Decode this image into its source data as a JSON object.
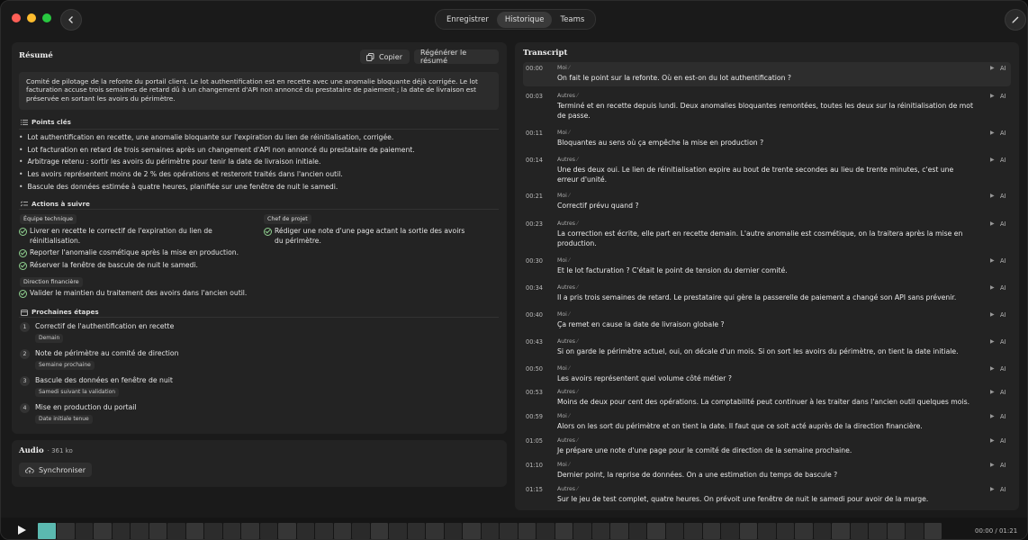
{
  "colors": {
    "accent": "#5bb9b0",
    "check": "#8fd08f",
    "red": "#ff5f57",
    "yellow": "#febc2e",
    "green": "#28c840"
  },
  "icons": {
    "back": "chevron-left-icon",
    "edit": "pencil-icon",
    "copy": "copy-icon",
    "sync": "cloud-sync-icon",
    "play": "play-icon"
  },
  "header": {
    "tabs": [
      "Enregistrer",
      "Historique",
      "Teams"
    ],
    "active_tab": "Historique"
  },
  "summary": {
    "title": "Résumé",
    "copy_label": "Copier",
    "regen_label": "Régénérer le résumé",
    "text": "Comité de pilotage de la refonte du portail client. Le lot authentification est en recette avec une anomalie bloquante déjà corrigée. Le lot facturation accuse trois semaines de retard dû à un changement d'API non annoncé du prestataire de paiement ; la date de livraison est préservée en sortant les avoirs du périmètre.",
    "key_points_title": "Points clés",
    "key_points": [
      "Lot authentification en recette, une anomalie bloquante sur l'expiration du lien de réinitialisation, corrigée.",
      "Lot facturation en retard de trois semaines après un changement d'API non annoncé du prestataire de paiement.",
      "Arbitrage retenu : sortir les avoirs du périmètre pour tenir la date de livraison initiale.",
      "Les avoirs représentent moins de 2 % des opérations et resteront traités dans l'ancien outil.",
      "Bascule des données estimée à quatre heures, planifiée sur une fenêtre de nuit le samedi."
    ],
    "actions_title": "Actions à suivre",
    "actions": {
      "tech_owner": "Équipe technique",
      "tech_items": [
        "Livrer en recette le correctif de l'expiration du lien de réinitialisation.",
        "Reporter l'anomalie cosmétique après la mise en production.",
        "Réserver la fenêtre de bascule de nuit le samedi."
      ],
      "project_owner": "Chef de projet",
      "project_items": [
        "Rédiger une note d'une page actant la sortie des avoirs du périmètre."
      ],
      "finance_owner": "Direction financière",
      "finance_items": [
        "Valider le maintien du traitement des avoirs dans l'ancien outil."
      ]
    },
    "next_steps_title": "Prochaines étapes",
    "next_steps": [
      {
        "num": "1",
        "title": "Correctif de l'authentification en recette",
        "when": "Demain"
      },
      {
        "num": "2",
        "title": "Note de périmètre au comité de direction",
        "when": "Semaine prochaine"
      },
      {
        "num": "3",
        "title": "Bascule des données en fenêtre de nuit",
        "when": "Samedi suivant la validation"
      },
      {
        "num": "4",
        "title": "Mise en production du portail",
        "when": "Date initiale tenue"
      }
    ]
  },
  "audio": {
    "title": "Audio",
    "size": "· 361 ko",
    "sync_label": "Synchroniser"
  },
  "transcript": {
    "title": "Transcript",
    "ai_label": "AI",
    "rows": [
      {
        "time": "00:00",
        "speaker": "Moi",
        "text": "On fait le point sur la refonte. Où en est-on du lot authentification ?"
      },
      {
        "time": "00:03",
        "speaker": "Autres",
        "text": "Terminé et en recette depuis lundi. Deux anomalies bloquantes remontées, toutes les deux sur la réinitialisation de mot de passe."
      },
      {
        "time": "00:11",
        "speaker": "Moi",
        "text": "Bloquantes au sens où ça empêche la mise en production ?"
      },
      {
        "time": "00:14",
        "speaker": "Autres",
        "text": "Une des deux oui. Le lien de réinitialisation expire au bout de trente secondes au lieu de trente minutes, c'est une erreur d'unité."
      },
      {
        "time": "00:21",
        "speaker": "Moi",
        "text": "Correctif prévu quand ?"
      },
      {
        "time": "00:23",
        "speaker": "Autres",
        "text": "La correction est écrite, elle part en recette demain. L'autre anomalie est cosmétique, on la traitera après la mise en production."
      },
      {
        "time": "00:30",
        "speaker": "Moi",
        "text": "Et le lot facturation ? C'était le point de tension du dernier comité."
      },
      {
        "time": "00:34",
        "speaker": "Autres",
        "text": "Il a pris trois semaines de retard. Le prestataire qui gère la passerelle de paiement a changé son API sans prévenir."
      },
      {
        "time": "00:40",
        "speaker": "Moi",
        "text": "Ça remet en cause la date de livraison globale ?"
      },
      {
        "time": "00:43",
        "speaker": "Autres",
        "text": "Si on garde le périmètre actuel, oui, on décale d'un mois. Si on sort les avoirs du périmètre, on tient la date initiale."
      },
      {
        "time": "00:50",
        "speaker": "Moi",
        "text": "Les avoirs représentent quel volume côté métier ?"
      },
      {
        "time": "00:53",
        "speaker": "Autres",
        "text": "Moins de deux pour cent des opérations. La comptabilité peut continuer à les traiter dans l'ancien outil quelques mois."
      },
      {
        "time": "00:59",
        "speaker": "Moi",
        "text": "Alors on les sort du périmètre et on tient la date. Il faut que ce soit acté auprès de la direction financière."
      },
      {
        "time": "01:05",
        "speaker": "Autres",
        "text": "Je prépare une note d'une page pour le comité de direction de la semaine prochaine."
      },
      {
        "time": "01:10",
        "speaker": "Moi",
        "text": "Dernier point, la reprise de données. On a une estimation du temps de bascule ?"
      },
      {
        "time": "01:15",
        "speaker": "Autres",
        "text": "Sur le jeu de test complet, quatre heures. On prévoit une fenêtre de nuit le samedi pour avoir de la marge."
      }
    ]
  },
  "player": {
    "time": "00:00 / 01:21"
  }
}
